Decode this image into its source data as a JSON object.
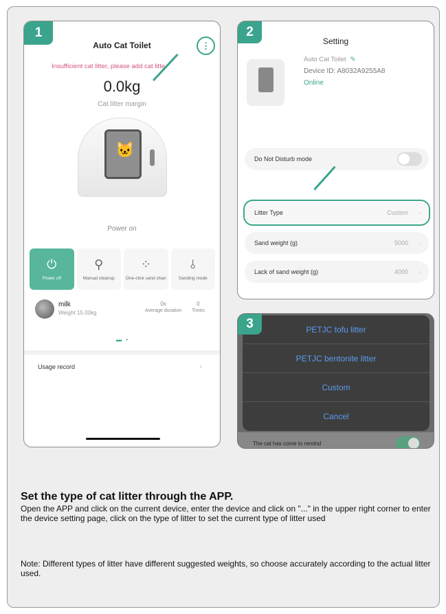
{
  "step1": {
    "number": "1",
    "title": "Auto Cat Toilet",
    "more_icon": "more-vertical-icon",
    "warning": "Insufficient cat litter, please add cat litte",
    "weight": "0.0kg",
    "weight_label": "Cat litter margin",
    "status": "Power on",
    "buttons": [
      {
        "label": "Power off",
        "icon": "power-icon"
      },
      {
        "label": "Manual cleanup",
        "icon": "shovel-icon"
      },
      {
        "label": "One-click sand chan",
        "icon": "sand-change-icon"
      },
      {
        "label": "Sanding mode",
        "icon": "sanding-icon"
      }
    ],
    "cat": {
      "name": "milk",
      "weight": "Weight 15.00kg"
    },
    "stats": [
      {
        "value": "0s",
        "label": "Average duration"
      },
      {
        "value": "0",
        "label": "Times"
      }
    ],
    "usage_record": "Usage record"
  },
  "step2": {
    "number": "2",
    "title": "Setting",
    "device_name": "Auto Cat Toilet",
    "device_id": "Device ID: A8032A9255A8",
    "status": "Online",
    "dnd": "Do Not Disturb mode",
    "litter_type": {
      "label": "Litter Type",
      "value": "Custom"
    },
    "sand_weight": {
      "label": "Sand weight (g)",
      "value": "5000"
    },
    "lack_weight": {
      "label": "Lack of sand weight (g)",
      "value": "4000"
    }
  },
  "step3": {
    "number": "3",
    "options": [
      "PETJC tofu litter",
      "PETJC bentonite litter",
      "Custom",
      "Cancel"
    ],
    "background_row": "The cat has come to remind"
  },
  "text": {
    "heading": "Set the type of cat litter through the APP.",
    "para1": "Open the APP and click on the current device, enter the device and click on \"...\" in the upper right corner to enter the device setting page, click on the type of litter to set the current type of litter used",
    "para2": "Note: Different types of litter have different suggested weights, so choose accurately according to the actual litter used."
  },
  "colors": {
    "accent": "#3aa48c",
    "warning": "#d4557a",
    "link_blue": "#5b9cf0"
  }
}
